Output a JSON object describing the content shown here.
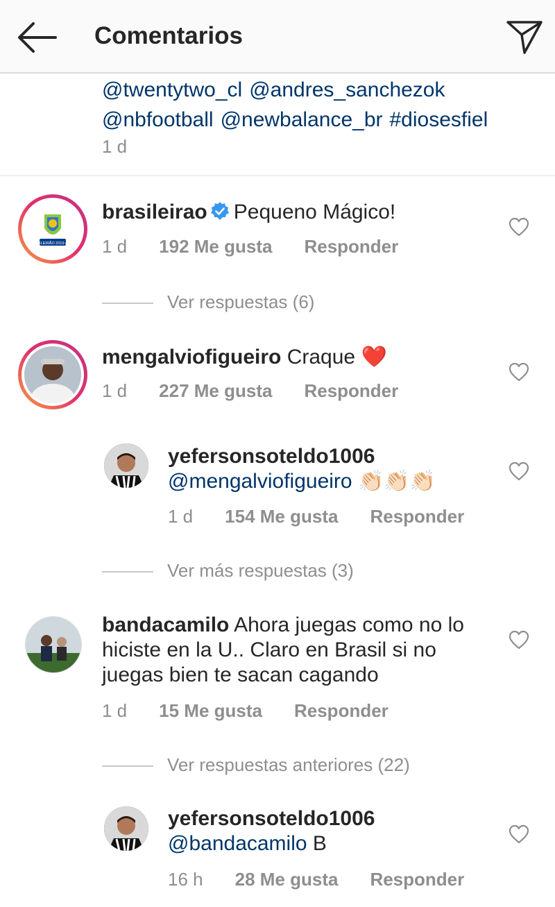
{
  "header": {
    "title": "Comentarios"
  },
  "caption": {
    "tags": [
      "@twentytwo_cl",
      "@andres_sanchezok",
      "@nbfootball",
      "@newbalance_br",
      "#diosesfiel"
    ],
    "time": "1 d"
  },
  "comments": [
    {
      "username": "brasileirao",
      "verified": true,
      "text": "Pequeno Mágico!",
      "time": "1 d",
      "likes": "192 Me gusta",
      "reply": "Responder",
      "avatar_text": "BRASILEIRÃO 2019 ASSAÍ",
      "view_replies": "Ver respuestas (6)"
    },
    {
      "username": "mengalviofigueiro",
      "text": "Craque",
      "emoji": "❤️",
      "time": "1 d",
      "likes": "227 Me gusta",
      "reply": "Responder"
    },
    {
      "username": "yefersonsoteldo1006",
      "mention": "@mengalviofigueiro",
      "emoji": "👏🏻👏🏻👏🏻",
      "time": "1 d",
      "likes": "154 Me gusta",
      "reply": "Responder",
      "view_replies": "Ver más respuestas (3)"
    },
    {
      "username": "bandacamilo",
      "text": "Ahora juegas como no lo hiciste en la U.. Claro en Brasil si no juegas bien te sacan cagando",
      "time": "1 d",
      "likes": "15 Me gusta",
      "reply": "Responder",
      "view_replies": "Ver respuestas anteriores (22)"
    },
    {
      "username": "yefersonsoteldo1006",
      "mention": "@bandacamilo",
      "text": "B",
      "time": "16 h",
      "likes": "28 Me gusta",
      "reply": "Responder"
    }
  ],
  "colors": {
    "link": "#003569",
    "secondary": "#8e8e8e",
    "verified": "#3897f0",
    "heart": "#ed4956"
  }
}
